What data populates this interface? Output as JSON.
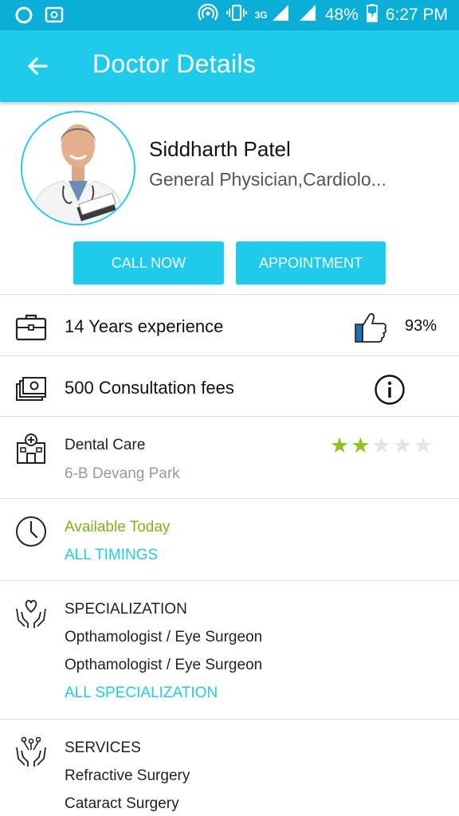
{
  "status_bar": {
    "network": "3G",
    "battery": "48%",
    "time": "6:27 PM"
  },
  "app_bar": {
    "title": "Doctor Details",
    "back_icon": "arrow-left-icon"
  },
  "doctor": {
    "name": "Siddharth Patel",
    "specialty": "General Physician,Cardiolo..."
  },
  "actions": {
    "call_label": "CALL NOW",
    "appointment_label": "APPOINTMENT"
  },
  "experience": {
    "text": "14 Years experience",
    "rating_percent": "93%"
  },
  "fees": {
    "text": "500 Consultation fees"
  },
  "clinic": {
    "name": "Dental Care",
    "address": "6-B Devang Park",
    "rating_stars": 2,
    "rating_max": 5
  },
  "availability": {
    "status": "Available Today",
    "link": "ALL TIMINGS"
  },
  "specialization": {
    "heading": "SPECIALIZATION",
    "items": [
      "Opthamologist / Eye Surgeon",
      "Opthamologist / Eye Surgeon"
    ],
    "link": "ALL SPECIALIZATION"
  },
  "services": {
    "heading": "SERVICES",
    "items": [
      "Refractive Surgery",
      "Cataract Surgery"
    ]
  },
  "colors": {
    "status_bar": "#0aaed6",
    "app_bar": "#1ecbeb",
    "accent": "#1ecbeb",
    "available": "#7cb518",
    "star_on": "#8dc21f"
  }
}
